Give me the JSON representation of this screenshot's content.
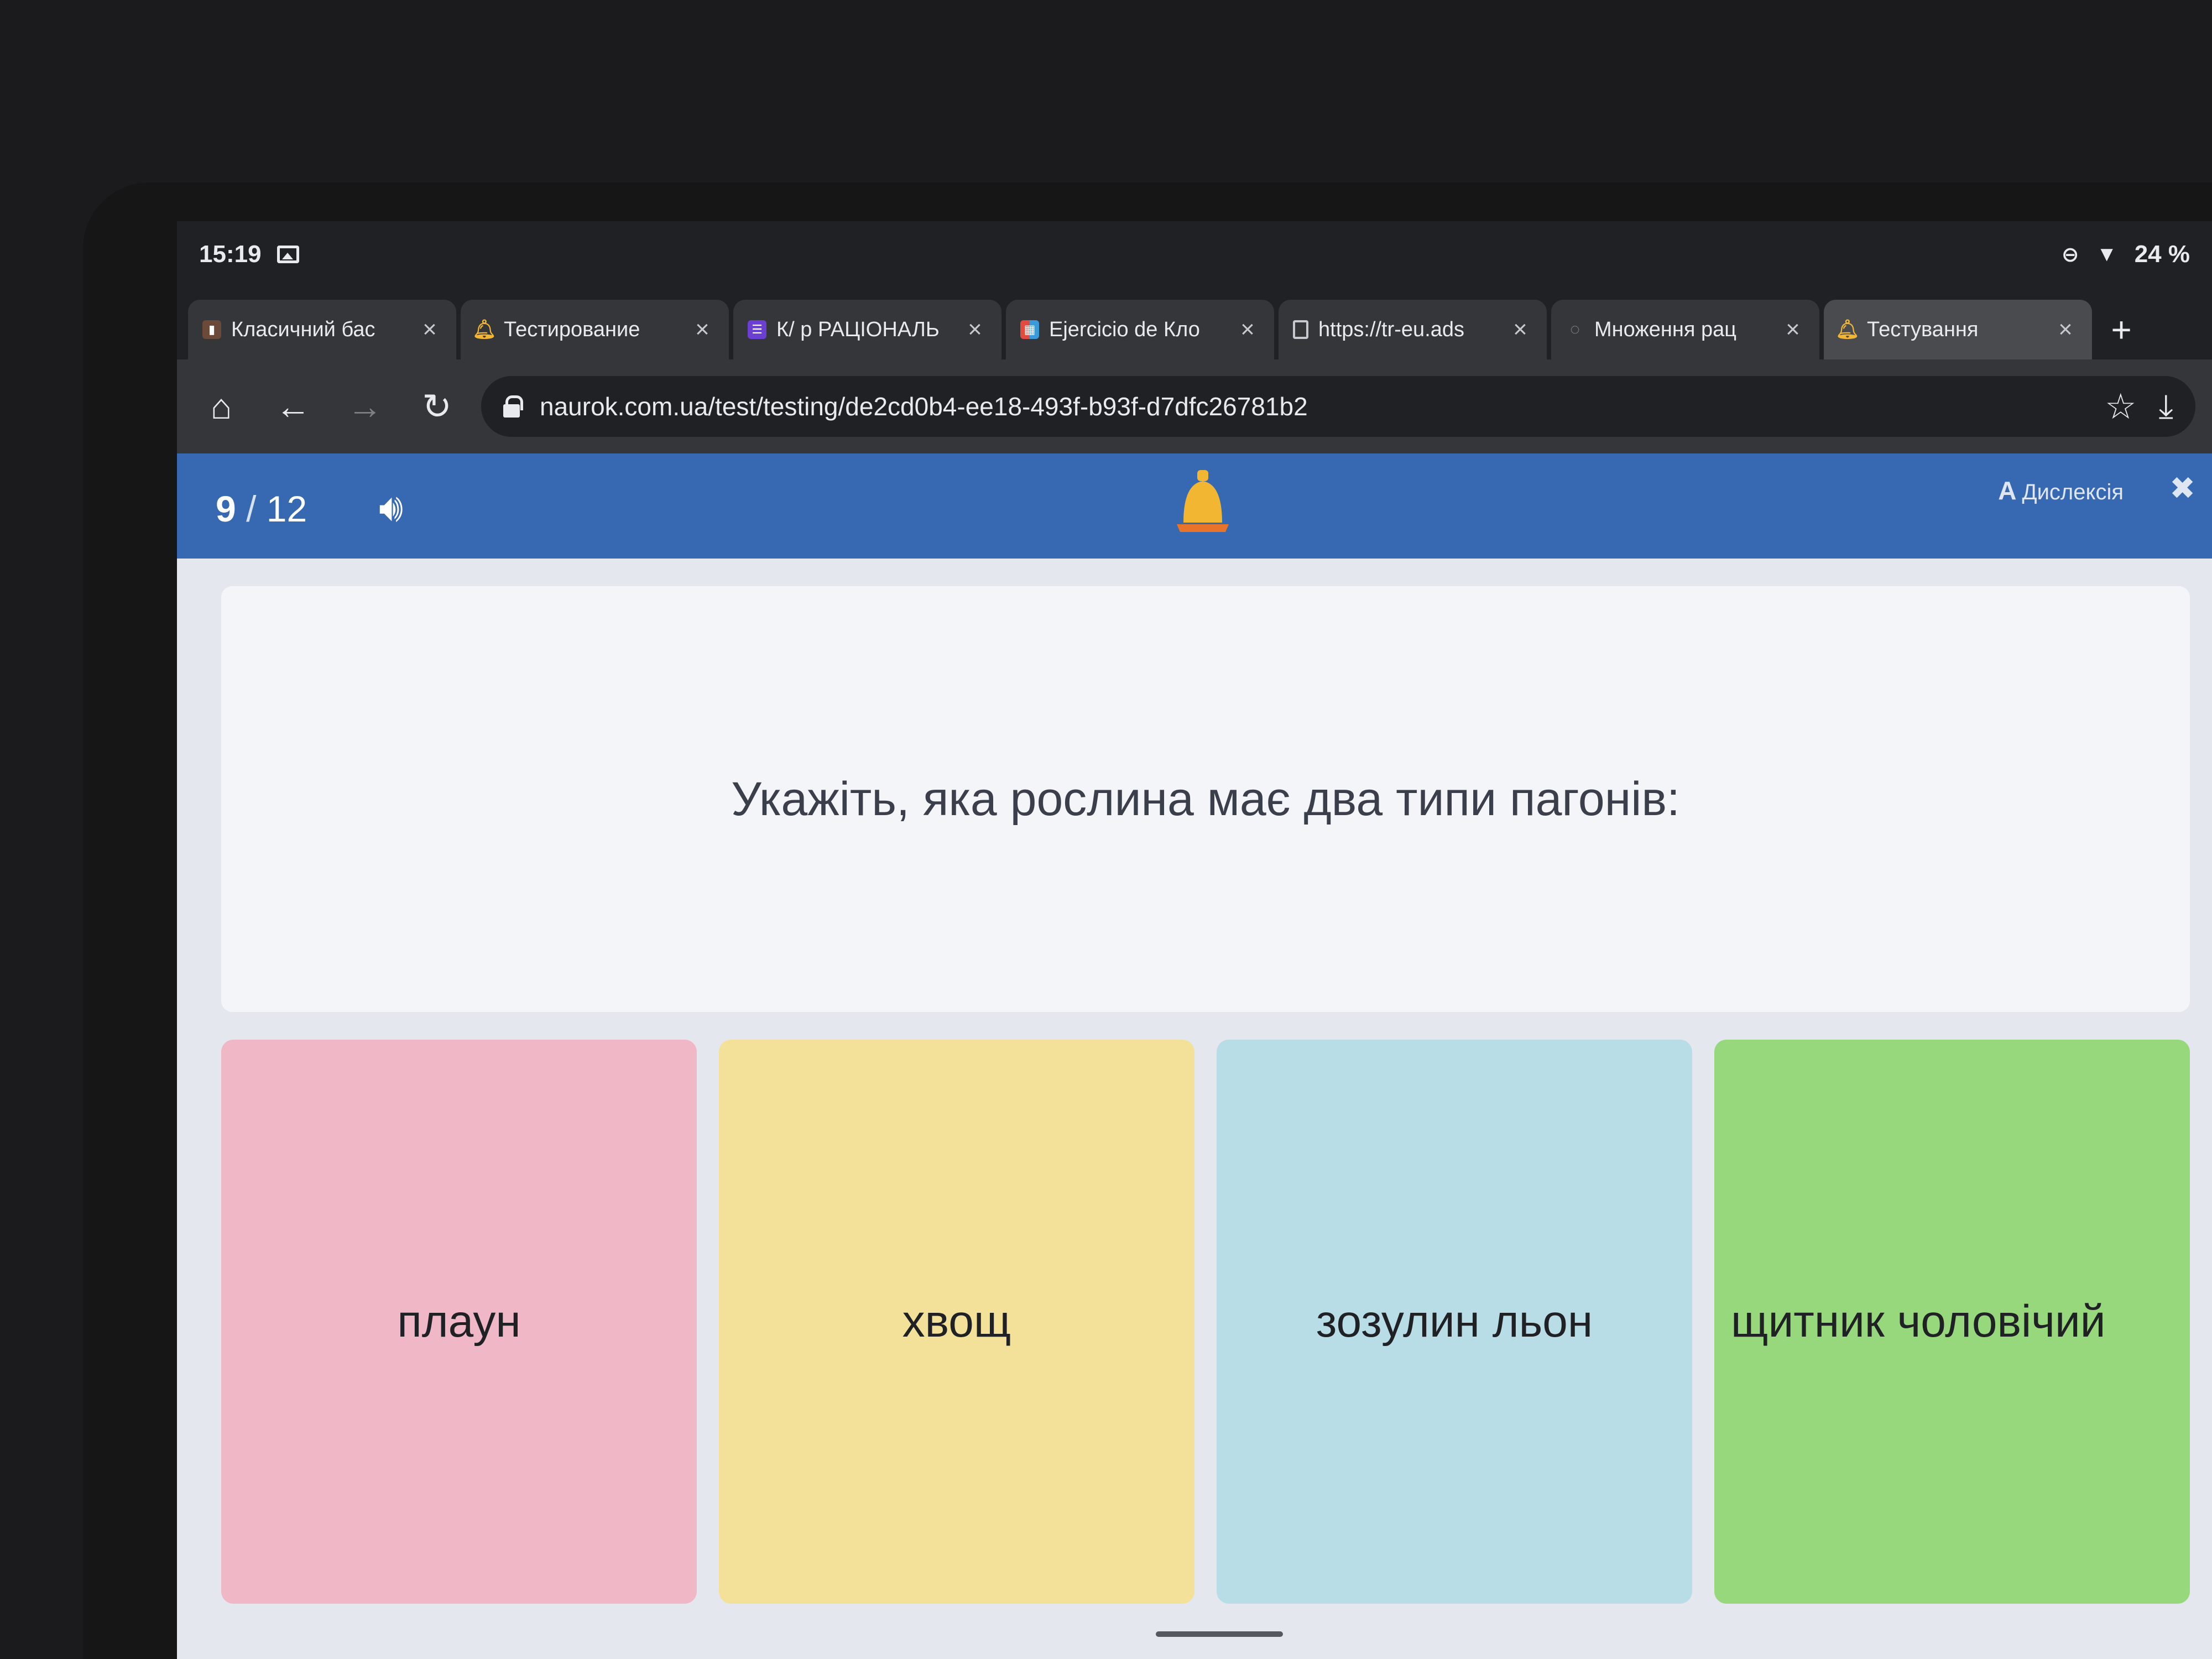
{
  "status_bar": {
    "time": "15:19",
    "battery": "24 %"
  },
  "tabs": [
    {
      "title": "Класичний бас",
      "favicon": "phone-favicon",
      "active": false
    },
    {
      "title": "Тестирование",
      "favicon": "bell-favicon",
      "active": false
    },
    {
      "title": "К/ р РАЦІОНАЛЬ",
      "favicon": "list-favicon",
      "active": false
    },
    {
      "title": "Ejercicio de Кло",
      "favicon": "game-favicon",
      "active": false
    },
    {
      "title": "https://tr-eu.ads",
      "favicon": "page-favicon",
      "active": false
    },
    {
      "title": "Множення рац",
      "favicon": "loading-favicon",
      "active": false
    },
    {
      "title": "Тестування",
      "favicon": "bell-favicon",
      "active": true
    }
  ],
  "omnibox": {
    "url": "naurok.com.ua/test/testing/de2cd0b4-ee18-493f-b93f-d7dfc26781b2"
  },
  "quiz": {
    "progress_current": "9",
    "progress_total": "12",
    "dyslexia_label": "Дислексія",
    "question": "Укажіть, яка рослина має два типи пагонів:",
    "answers": [
      {
        "text": "плаун"
      },
      {
        "text": "хвощ"
      },
      {
        "text": "зозулин льон"
      },
      {
        "text": "щитник чоловічий"
      }
    ]
  }
}
